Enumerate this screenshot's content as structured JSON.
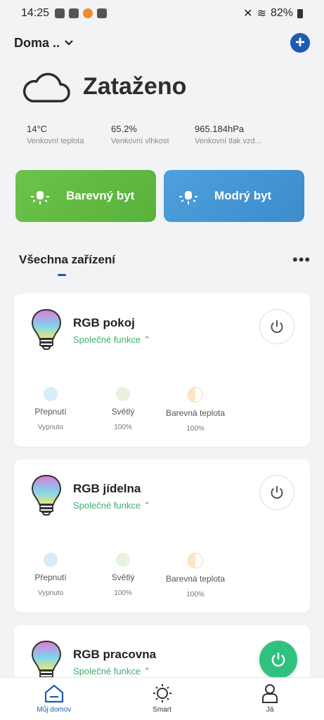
{
  "status_bar": {
    "time": "14:25",
    "battery": "82%"
  },
  "header": {
    "home_name": "Doma ..",
    "add_icon": "plus-icon"
  },
  "weather": {
    "condition": "Zataženo",
    "stats": [
      {
        "value": "14°C",
        "label": "Venkovní teplota"
      },
      {
        "value": "65.2%",
        "label": "Venkovní vlhkost"
      },
      {
        "value": "965.184hPa",
        "label": "Venkovní tlak vzd..."
      }
    ]
  },
  "scenes": [
    {
      "label": "Barevný byt",
      "color": "#62bb44"
    },
    {
      "label": "Modrý byt",
      "color": "#4595d6"
    }
  ],
  "devices_section": {
    "title": "Všechna zařízení"
  },
  "devices": [
    {
      "name": "RGB pokoj",
      "functions_label": "Společné funkce",
      "metrics": [
        {
          "name": "Přepnutí",
          "value": "Vypnuto"
        },
        {
          "name": "Světlý",
          "value": "100%"
        },
        {
          "name": "Barevná teplota",
          "value": "100%"
        }
      ]
    },
    {
      "name": "RGB jídelna",
      "functions_label": "Společné funkce",
      "metrics": [
        {
          "name": "Přepnutí",
          "value": "Vypnuto"
        },
        {
          "name": "Světlý",
          "value": "100%"
        },
        {
          "name": "Barevná teplota",
          "value": "100%"
        }
      ]
    },
    {
      "name": "RGB pracovna",
      "functions_label": "Společné funkce"
    }
  ],
  "bottom_nav": [
    {
      "label": "Můj domov",
      "icon": "home-icon",
      "active": true
    },
    {
      "label": "Smart",
      "icon": "sun-icon",
      "active": false
    },
    {
      "label": "Já",
      "icon": "person-icon",
      "active": false
    }
  ],
  "colors": {
    "accent": "#1f5bb0",
    "green_text": "#3bb06d",
    "fab": "#2ec27e"
  }
}
